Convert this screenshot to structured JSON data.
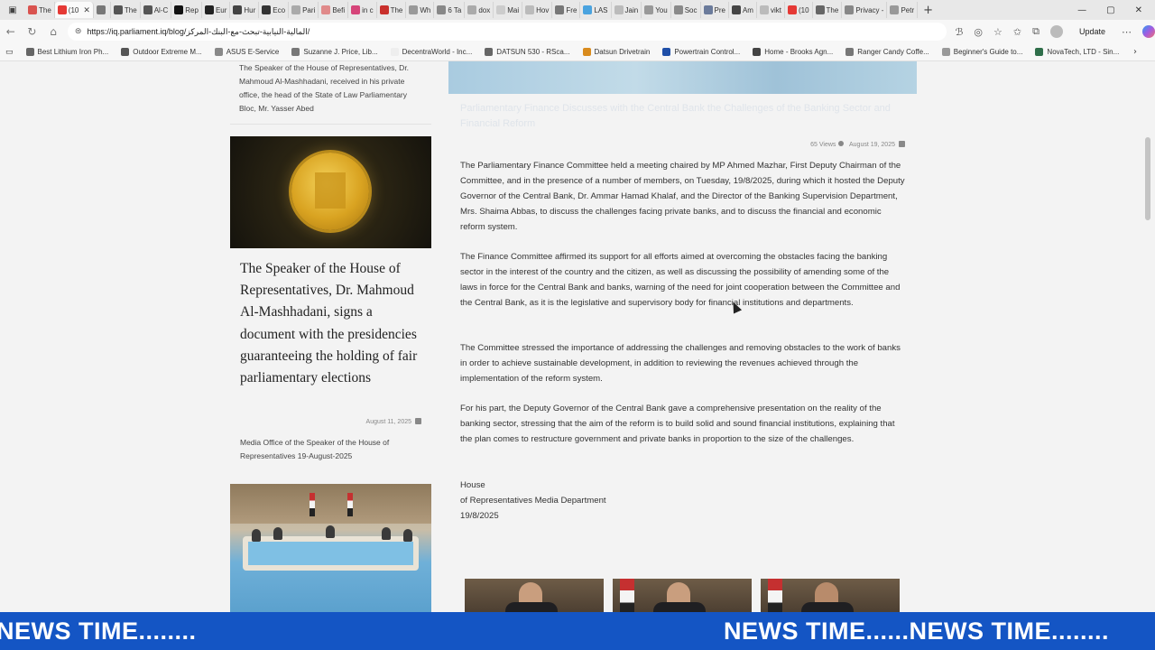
{
  "browser": {
    "tabs": [
      {
        "label": "The",
        "color": "#d9534f"
      },
      {
        "label": "(10",
        "color": "#e53935",
        "active": true
      },
      {
        "label": "",
        "color": "#777777"
      },
      {
        "label": "The",
        "color": "#555555"
      },
      {
        "label": "Al-C",
        "color": "#555555"
      },
      {
        "label": "Rep",
        "color": "#111111"
      },
      {
        "label": "Eur",
        "color": "#222222"
      },
      {
        "label": "Hur",
        "color": "#444444"
      },
      {
        "label": "Eco",
        "color": "#333333"
      },
      {
        "label": "Pari",
        "color": "#aaaaaa"
      },
      {
        "label": "Befi",
        "color": "#e08a8a"
      },
      {
        "label": "in c",
        "color": "#d6457a"
      },
      {
        "label": "The",
        "color": "#c9302c"
      },
      {
        "label": "Wh",
        "color": "#999999"
      },
      {
        "label": "6 Ta",
        "color": "#888888"
      },
      {
        "label": "dox",
        "color": "#aaaaaa"
      },
      {
        "label": "Mai",
        "color": "#cccccc"
      },
      {
        "label": "Hov",
        "color": "#bbbbbb"
      },
      {
        "label": "Fre",
        "color": "#777777"
      },
      {
        "label": "LAS",
        "color": "#4aa3df"
      },
      {
        "label": "Jain",
        "color": "#bbbbbb"
      },
      {
        "label": "You",
        "color": "#999999"
      },
      {
        "label": "Soc",
        "color": "#8a8a8a"
      },
      {
        "label": "Pre",
        "color": "#6b7b9b"
      },
      {
        "label": "Am",
        "color": "#444444"
      },
      {
        "label": "vikt",
        "color": "#bbbbbb"
      },
      {
        "label": "(10",
        "color": "#e53935"
      },
      {
        "label": "The",
        "color": "#666666"
      },
      {
        "label": "Privacy -",
        "color": "#888888"
      },
      {
        "label": "Petr",
        "color": "#999999"
      }
    ],
    "url": "https://iq.parliament.iq/blog/المالية-النيابية-تبحث-مع-البنك-المركز/",
    "update_label": "Update",
    "bookmarks": [
      {
        "label": "Best Lithium Iron Ph...",
        "color": "#666666"
      },
      {
        "label": "Outdoor Extreme M...",
        "color": "#555555"
      },
      {
        "label": "ASUS E-Service",
        "color": "#888888"
      },
      {
        "label": "Suzanne J. Price, Lib...",
        "color": "#777777"
      },
      {
        "label": "DecentraWorld - Inc...",
        "color": "#eeeeee"
      },
      {
        "label": "DATSUN 530 - RSca...",
        "color": "#666666"
      },
      {
        "label": "Datsun Drivetrain",
        "color": "#d98b1d"
      },
      {
        "label": "Powertrain Control...",
        "color": "#1f4fa8"
      },
      {
        "label": "Home - Brooks Agn...",
        "color": "#444444"
      },
      {
        "label": "Ranger Candy Coffe...",
        "color": "#777777"
      },
      {
        "label": "Beginner's Guide to...",
        "color": "#999999"
      },
      {
        "label": "NovaTech, LTD - Sin...",
        "color": "#2f6e4a"
      }
    ]
  },
  "sidebar": {
    "prev_card_text": "The Speaker of the House of Representatives, Dr. Mahmoud Al-Mashhadani, received in his private office, the head of the State of Law Parliamentary Bloc, Mr. Yasser Abed",
    "feature": {
      "title": "The Speaker of the House of Representatives, Dr. Mahmoud Al-Mashhadani, signs a document with the presidencies guaranteeing the holding of fair parliamentary elections",
      "date": "August 11, 2025",
      "source": "Media Office of the Speaker of the House of Representatives 19-August-2025"
    }
  },
  "article": {
    "title": "Parliamentary Finance Discusses with the Central Bank the Challenges of the Banking Sector and Financial Reform",
    "views": "65 Views",
    "date": "August 19, 2025",
    "paragraphs": [
      "The Parliamentary Finance Committee held a meeting chaired by MP Ahmed Mazhar, First Deputy Chairman of the Committee, and in the presence of a number of members, on Tuesday, 19/8/2025, during which it hosted the Deputy Governor of the Central Bank, Dr. Ammar Hamad Khalaf, and the Director of the Banking Supervision Department, Mrs. Shaima Abbas, to discuss the challenges facing private banks, and to discuss the financial and economic reform system.",
      "The Finance Committee affirmed its support for all efforts aimed at overcoming the obstacles facing the banking sector in the interest of the country and the citizen, as well as discussing the possibility of amending some of the laws in force for the Central Bank and banks, warning of the need for joint cooperation between the Committee and the Central Bank, as it is the legislative and supervisory body for financial institutions and departments.",
      "The Committee stressed the importance of addressing the challenges and removing obstacles to the work of banks in order to achieve sustainable development, in addition to reviewing the revenues achieved through the implementation of the reform system.",
      "For his part, the Deputy Governor of the Central Bank gave a comprehensive presentation on the reality of the banking sector, stressing that the aim of the reform is to build solid and sound financial institutions, explaining that the plan comes to restructure government and private banks in proportion to the size of the challenges."
    ],
    "signature": {
      "line1": "House",
      "line2": "of Representatives Media Department",
      "date": "19/8/2025"
    }
  },
  "ticker": {
    "left_text": "NEWS TIME........",
    "right_text": "NEWS TIME......NEWS TIME........",
    "color": "#1455c4"
  }
}
